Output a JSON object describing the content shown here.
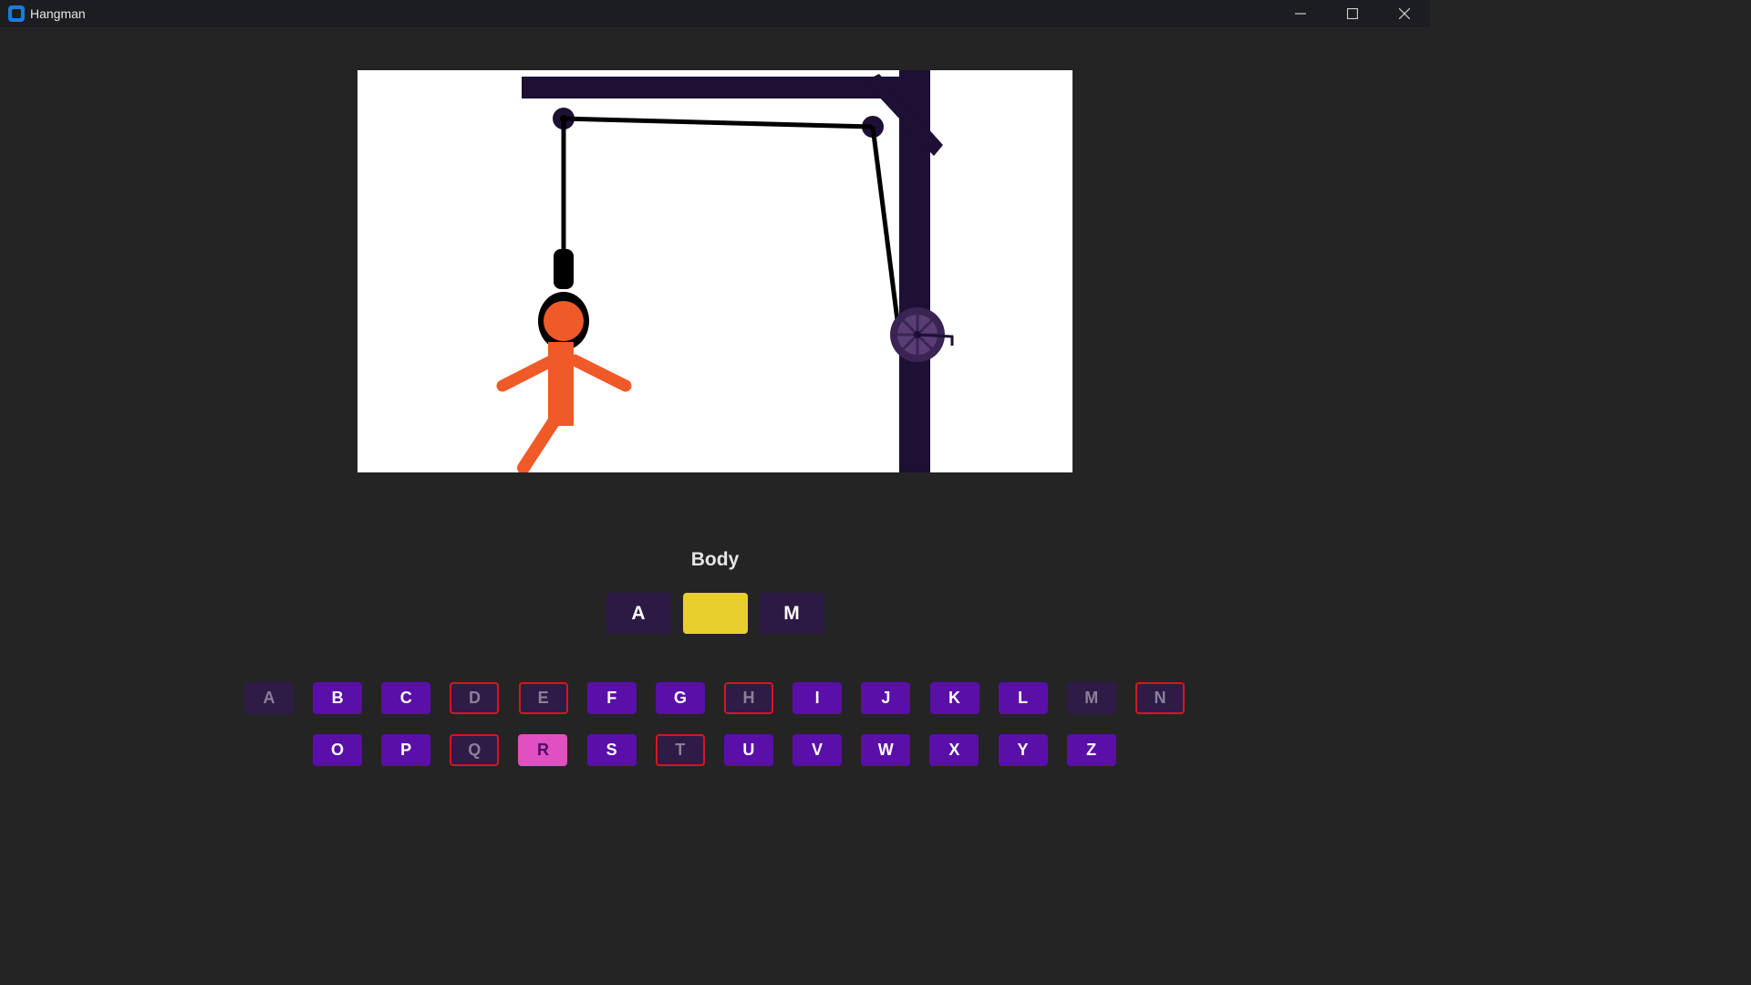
{
  "window": {
    "title": "Hangman",
    "icon": "app-icon",
    "controls": [
      "minimize-icon",
      "maximize-icon",
      "close-icon"
    ]
  },
  "scene": {
    "description_icons": [
      "gallows",
      "rope",
      "pulley",
      "wheel",
      "stick-figure"
    ],
    "colors": {
      "gallows": "#1e0f35",
      "figure": "#f05a28",
      "rope": "#000000"
    }
  },
  "game": {
    "category": "Body",
    "word_slots": [
      {
        "letter": "A",
        "state": "revealed"
      },
      {
        "letter": "",
        "state": "blank"
      },
      {
        "letter": "M",
        "state": "revealed"
      }
    ]
  },
  "keyboard": {
    "row1": [
      {
        "letter": "A",
        "state": "used-correct"
      },
      {
        "letter": "B",
        "state": "available"
      },
      {
        "letter": "C",
        "state": "available"
      },
      {
        "letter": "D",
        "state": "used-wrong"
      },
      {
        "letter": "E",
        "state": "used-wrong"
      },
      {
        "letter": "F",
        "state": "available"
      },
      {
        "letter": "G",
        "state": "available"
      },
      {
        "letter": "H",
        "state": "used-wrong"
      },
      {
        "letter": "I",
        "state": "available"
      },
      {
        "letter": "J",
        "state": "available"
      },
      {
        "letter": "K",
        "state": "available"
      },
      {
        "letter": "L",
        "state": "available"
      },
      {
        "letter": "M",
        "state": "used-correct"
      },
      {
        "letter": "N",
        "state": "used-wrong"
      }
    ],
    "row2": [
      {
        "letter": "O",
        "state": "available"
      },
      {
        "letter": "P",
        "state": "available"
      },
      {
        "letter": "Q",
        "state": "used-wrong"
      },
      {
        "letter": "R",
        "state": "selected"
      },
      {
        "letter": "S",
        "state": "available"
      },
      {
        "letter": "T",
        "state": "used-wrong"
      },
      {
        "letter": "U",
        "state": "available"
      },
      {
        "letter": "V",
        "state": "available"
      },
      {
        "letter": "W",
        "state": "available"
      },
      {
        "letter": "X",
        "state": "available"
      },
      {
        "letter": "Y",
        "state": "available"
      },
      {
        "letter": "Z",
        "state": "available"
      }
    ],
    "colors": {
      "available": "#5a0fa8",
      "used": "#2e1b46",
      "wrong_border": "#d9161e",
      "selected": "#e050c0",
      "blank_slot": "#e8cf2e"
    }
  }
}
